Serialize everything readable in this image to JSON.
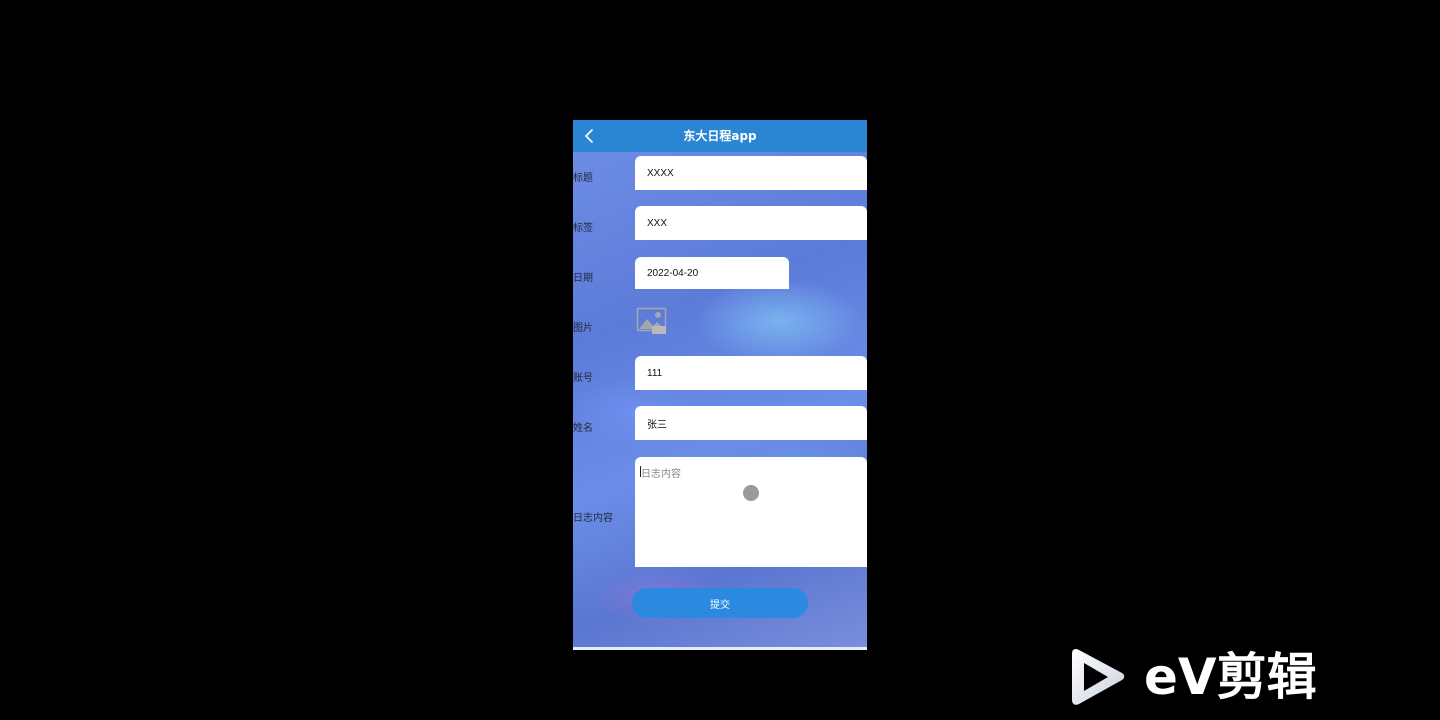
{
  "header": {
    "title": "东大日程app",
    "back_icon": "chevron-left-icon"
  },
  "form": {
    "fields": [
      {
        "label": "标题",
        "value": "XXXX"
      },
      {
        "label": "标签",
        "value": "XXX"
      },
      {
        "label": "日期",
        "value": "2022-04-20"
      },
      {
        "label": "图片",
        "value": "",
        "icon": "image-placeholder-icon"
      },
      {
        "label": "账号",
        "value": "111"
      },
      {
        "label": "姓名",
        "value": "张三"
      },
      {
        "label": "日志内容",
        "value": "",
        "placeholder": "日志内容"
      }
    ],
    "submit_label": "提交"
  },
  "watermark": {
    "text": "eV剪辑",
    "icon": "play-logo-icon"
  },
  "colors": {
    "header_bg": "#2a86d2",
    "submit_bg": "#2b8ae0",
    "page_bg": "#000000"
  }
}
